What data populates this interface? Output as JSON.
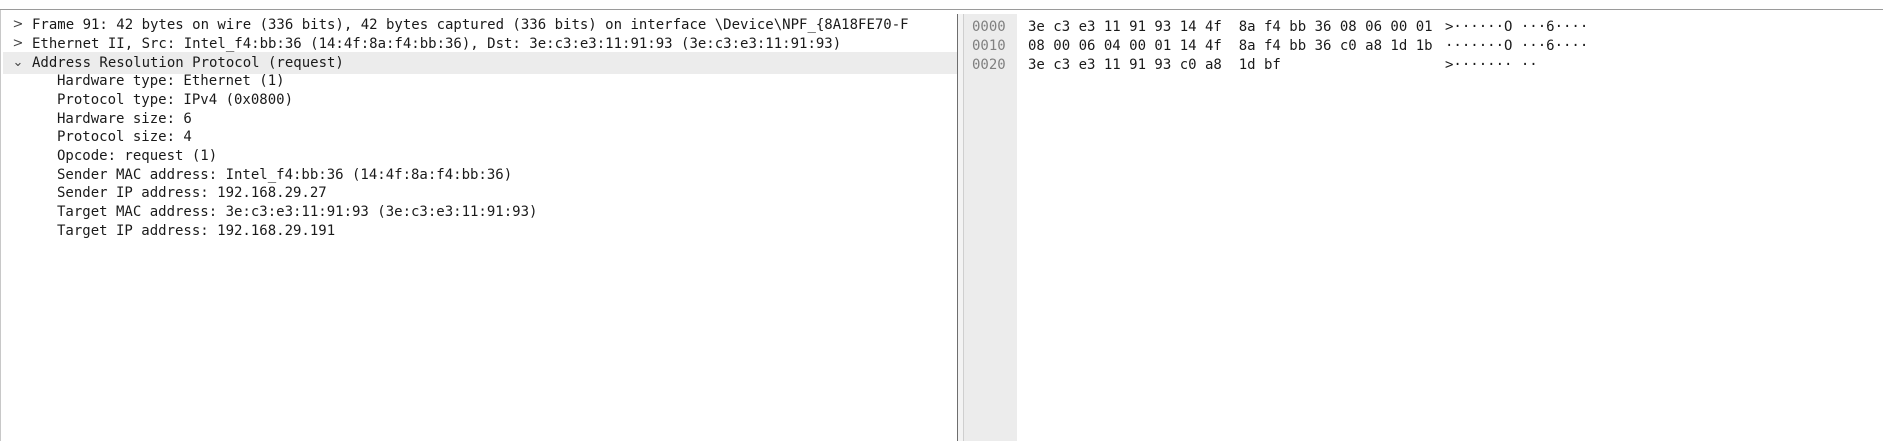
{
  "details": {
    "tree": [
      {
        "arrow": ">",
        "text": "Frame 91: 42 bytes on wire (336 bits), 42 bytes captured (336 bits) on interface \\Device\\NPF_{8A18FE70-F",
        "expanded": false
      },
      {
        "arrow": ">",
        "text": "Ethernet II, Src: Intel_f4:bb:36 (14:4f:8a:f4:bb:36), Dst: 3e:c3:e3:11:91:93 (3e:c3:e3:11:91:93)",
        "expanded": false
      },
      {
        "arrow": "⌄",
        "text": "Address Resolution Protocol (request)",
        "expanded": true
      }
    ],
    "fields": [
      "Hardware type: Ethernet (1)",
      "Protocol type: IPv4 (0x0800)",
      "Hardware size: 6",
      "Protocol size: 4",
      "Opcode: request (1)",
      "Sender MAC address: Intel_f4:bb:36 (14:4f:8a:f4:bb:36)",
      "Sender IP address: 192.168.29.27",
      "Target MAC address: 3e:c3:e3:11:91:93 (3e:c3:e3:11:91:93)",
      "Target IP address: 192.168.29.191"
    ]
  },
  "bytes": {
    "rows": [
      {
        "offset": "0000",
        "hex": "3e c3 e3 11 91 93 14 4f  8a f4 bb 36 08 06 00 01",
        "ascii": ">······O ···6····"
      },
      {
        "offset": "0010",
        "hex": "08 00 06 04 00 01 14 4f  8a f4 bb 36 c0 a8 1d 1b",
        "ascii": "·······O ···6····"
      },
      {
        "offset": "0020",
        "hex": "3e c3 e3 11 91 93 c0 a8  1d bf",
        "ascii": ">······· ··"
      }
    ]
  }
}
